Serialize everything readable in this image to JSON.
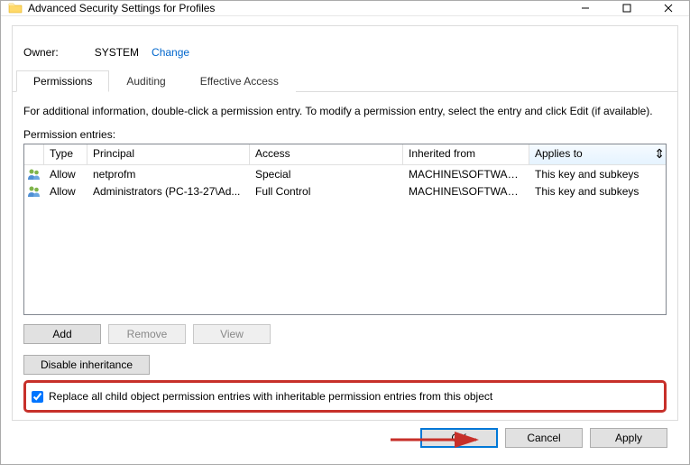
{
  "window": {
    "title": "Advanced Security Settings for Profiles"
  },
  "owner": {
    "label": "Owner:",
    "value": "SYSTEM",
    "change": "Change"
  },
  "tabs": {
    "permissions": "Permissions",
    "auditing": "Auditing",
    "effective": "Effective Access"
  },
  "info": "For additional information, double-click a permission entry. To modify a permission entry, select the entry and click Edit (if available).",
  "entries_label": "Permission entries:",
  "columns": {
    "type": "Type",
    "principal": "Principal",
    "access": "Access",
    "inherited": "Inherited from",
    "applies": "Applies to"
  },
  "entries": [
    {
      "type": "Allow",
      "principal": "netprofm",
      "access": "Special",
      "inherited": "MACHINE\\SOFTWARE...",
      "applies": "This key and subkeys"
    },
    {
      "type": "Allow",
      "principal": "Administrators (PC-13-27\\Ad...",
      "access": "Full Control",
      "inherited": "MACHINE\\SOFTWARE...",
      "applies": "This key and subkeys"
    }
  ],
  "buttons": {
    "add": "Add",
    "remove": "Remove",
    "view": "View",
    "disable_inheritance": "Disable inheritance",
    "ok": "OK",
    "cancel": "Cancel",
    "apply": "Apply"
  },
  "checkbox": {
    "checked": true,
    "label": "Replace all child object permission entries with inheritable permission entries from this object"
  }
}
